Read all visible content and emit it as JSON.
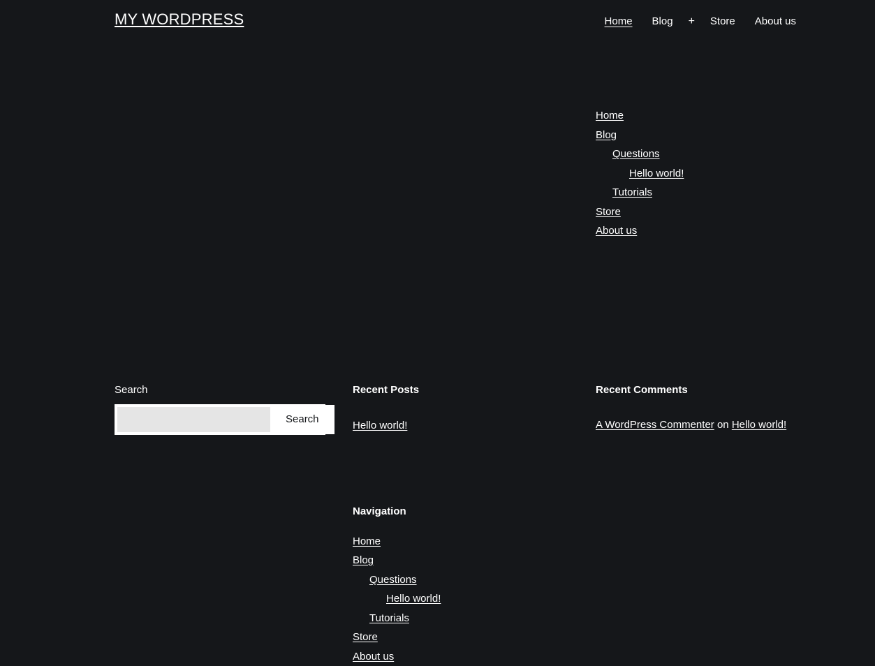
{
  "site": {
    "title": "MY WORDPRESS",
    "background_color": "#15171a",
    "text_color": "#ffffff",
    "accent_color": "#ffffff"
  },
  "header": {
    "nav": [
      {
        "label": "Home",
        "current": true
      },
      {
        "label": "Blog",
        "current": false
      },
      {
        "label": "Store",
        "current": false
      },
      {
        "label": "About us",
        "current": false
      }
    ],
    "submenu_toggle": "+",
    "submenu_toggle_icon": "plus-icon"
  },
  "content_nav": {
    "items": [
      {
        "label": "Home",
        "children": []
      },
      {
        "label": "Blog",
        "children": [
          {
            "label": "Questions",
            "children": [
              {
                "label": "Hello world!",
                "children": []
              }
            ]
          },
          {
            "label": "Tutorials",
            "children": []
          }
        ]
      },
      {
        "label": "Store",
        "children": []
      },
      {
        "label": "About us",
        "children": []
      }
    ]
  },
  "footer": {
    "search_widget": {
      "label": "Search",
      "input_value": "",
      "input_placeholder": "",
      "button_label": "Search"
    },
    "recent_posts": {
      "title": "Recent Posts",
      "items": [
        {
          "label": "Hello world!"
        }
      ]
    },
    "recent_comments": {
      "title": "Recent Comments",
      "items": [
        {
          "author": "A WordPress Commenter",
          "separator": "on",
          "post": "Hello world!"
        }
      ]
    },
    "navigation_widget": {
      "title": "Navigation",
      "items": [
        {
          "label": "Home",
          "children": []
        },
        {
          "label": "Blog",
          "children": [
            {
              "label": "Questions",
              "children": [
                {
                  "label": "Hello world!",
                  "children": []
                }
              ]
            },
            {
              "label": "Tutorials",
              "children": []
            }
          ]
        },
        {
          "label": "Store",
          "children": []
        },
        {
          "label": "About us",
          "children": []
        }
      ]
    }
  }
}
